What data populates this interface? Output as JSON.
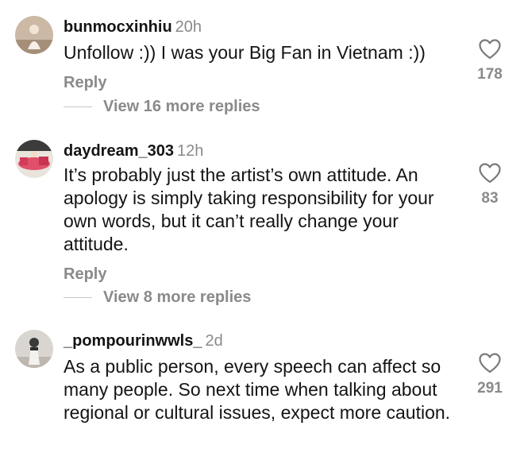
{
  "comments": [
    {
      "username": "bunmocxinhiu",
      "time": "20h",
      "text": "Unfollow :)) I was your Big Fan in Vietnam :))",
      "reply_label": "Reply",
      "more_replies": "View 16 more replies",
      "likes": "178",
      "avatar_icon": "user-photo-avatar"
    },
    {
      "username": "daydream_303",
      "time": "12h",
      "text": "It’s probably just the artist’s own attitude. An apology is simply taking responsibility for your own words, but it can’t really change your attitude.",
      "reply_label": "Reply",
      "more_replies": "View 8 more replies",
      "likes": "83",
      "avatar_icon": "user-photo-avatar"
    },
    {
      "username": "_pompourinwwls_",
      "time": "2d",
      "text": "As a public person, every speech can affect so many people. So next time when talking about regional or cultural issues, expect more caution.",
      "likes": "291",
      "avatar_icon": "user-photo-avatar"
    }
  ],
  "colors": {
    "text_primary": "#141414",
    "text_secondary": "#8a8a8a",
    "divider": "#c8c8c8"
  },
  "icons": {
    "like": "heart-outline-icon"
  }
}
